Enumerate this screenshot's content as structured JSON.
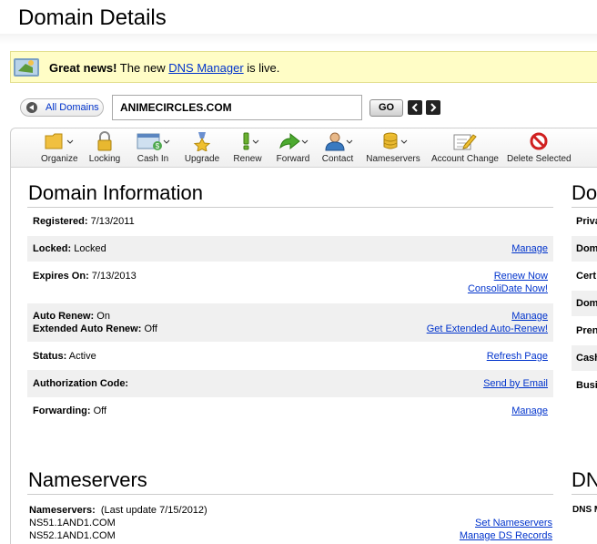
{
  "header": {
    "title": "Domain Details"
  },
  "notice": {
    "bold": "Great news!",
    "pre": " The new ",
    "link": "DNS Manager",
    "post": " is live."
  },
  "nav": {
    "all_domains": "All Domains",
    "domain": "ANIMECIRCLES.COM",
    "go": "GO"
  },
  "toolbar": [
    {
      "label": "Organize",
      "icon": "folder-icon"
    },
    {
      "label": "Locking",
      "icon": "lock-icon"
    },
    {
      "label": "Cash In",
      "icon": "cash-in-icon"
    },
    {
      "label": "Upgrade",
      "icon": "upgrade-icon"
    },
    {
      "label": "Renew",
      "icon": "renew-icon"
    },
    {
      "label": "Forward",
      "icon": "forward-arrow-icon"
    },
    {
      "label": "Contact",
      "icon": "contact-icon"
    },
    {
      "label": "Nameservers",
      "icon": "nameservers-icon"
    },
    {
      "label": "Account Change",
      "icon": "account-change-icon"
    },
    {
      "label": "Delete Selected",
      "icon": "delete-icon"
    }
  ],
  "domain_info": {
    "title": "Domain Information",
    "registered_label": "Registered:",
    "registered_value": " 7/13/2011",
    "locked_label": "Locked:",
    "locked_value": " Locked",
    "locked_action": "Manage",
    "expires_label": "Expires On:",
    "expires_value": " 7/13/2013",
    "renew_now": "Renew Now",
    "consolidate_now": "ConsoliDate Now!",
    "auto_renew_label": "Auto Renew:",
    "auto_renew_value": " On",
    "auto_renew_action": "Manage",
    "ext_auto_renew_label": "Extended Auto Renew:",
    "ext_auto_renew_value": " Off",
    "ext_auto_renew_action": "Get Extended Auto-Renew!",
    "status_label": "Status:",
    "status_value": " Active",
    "status_action": "Refresh Page",
    "auth_label": "Authorization Code:",
    "auth_action": "Send by Email",
    "forwarding_label": "Forwarding:",
    "forwarding_value": " Off",
    "forwarding_action": "Manage"
  },
  "nameservers": {
    "title": "Nameservers",
    "label": "Nameservers:",
    "last_update": "  (Last update 7/15/2012)",
    "ns1": "NS51.1AND1.COM",
    "ns2": "NS52.1AND1.COM",
    "set_action": "Set Nameservers",
    "ds_action": "Manage DS Records"
  },
  "right_column": {
    "title": "Do",
    "rows": [
      "Priva",
      "Dom",
      "Cert",
      "Dom",
      "Pren",
      "Cash",
      "Busi"
    ],
    "dns_title": "DN",
    "dns_row": "DNS M"
  },
  "colors": {
    "link": "#0033cc",
    "notice_bg": "#fffdc6",
    "row_shade": "#f0f0f0"
  }
}
